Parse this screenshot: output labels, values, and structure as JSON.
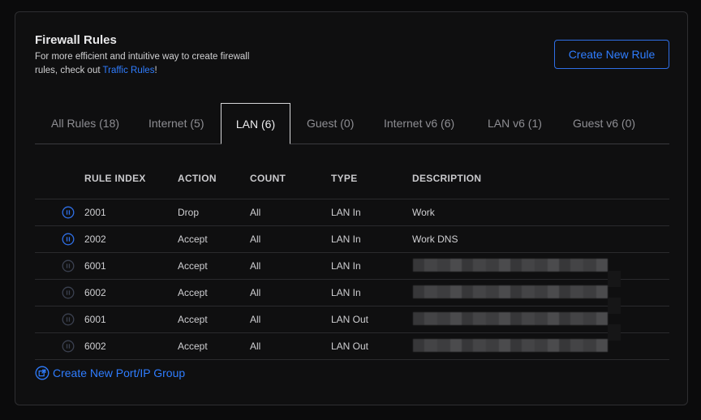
{
  "header": {
    "title": "Firewall Rules",
    "subtitle_text": "For more efficient and intuitive way to create firewall rules, check out ",
    "subtitle_link": "Traffic Rules",
    "subtitle_end": "!",
    "create_button": "Create New Rule"
  },
  "tabs": [
    {
      "label": "All Rules (18)",
      "active": false
    },
    {
      "label": "Internet (5)",
      "active": false
    },
    {
      "label": "LAN (6)",
      "active": true
    },
    {
      "label": "Guest (0)",
      "active": false
    },
    {
      "label": "Internet v6 (6)",
      "active": false
    },
    {
      "label": "LAN v6 (1)",
      "active": false
    },
    {
      "label": "Guest v6 (0)",
      "active": false
    }
  ],
  "table": {
    "columns": [
      "RULE INDEX",
      "ACTION",
      "COUNT",
      "TYPE",
      "DESCRIPTION"
    ],
    "rows": [
      {
        "index": "2001",
        "action": "Drop",
        "count": "All",
        "type": "LAN In",
        "description": "Work",
        "enabled": true
      },
      {
        "index": "2002",
        "action": "Accept",
        "count": "All",
        "type": "LAN In",
        "description": "Work DNS",
        "enabled": true
      },
      {
        "index": "6001",
        "action": "Accept",
        "count": "All",
        "type": "LAN In",
        "description": "",
        "enabled": false
      },
      {
        "index": "6002",
        "action": "Accept",
        "count": "All",
        "type": "LAN In",
        "description": "",
        "enabled": false
      },
      {
        "index": "6001",
        "action": "Accept",
        "count": "All",
        "type": "LAN Out",
        "description": "",
        "enabled": false
      },
      {
        "index": "6002",
        "action": "Accept",
        "count": "All",
        "type": "LAN Out",
        "description": "",
        "enabled": false
      }
    ]
  },
  "footer": {
    "group_link": "Create New Port/IP Group"
  },
  "colors": {
    "accent": "#2f7dff",
    "icon_enabled": "#2f6fe6",
    "icon_disabled": "#3b4150"
  }
}
